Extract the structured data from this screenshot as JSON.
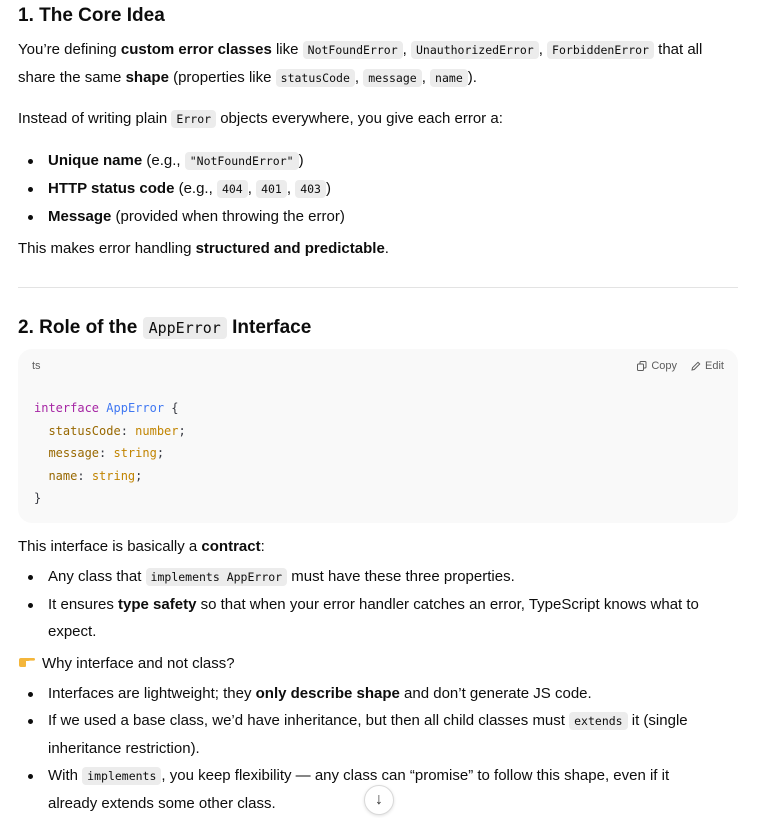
{
  "s1": {
    "title": "1. The Core Idea",
    "p1": [
      "You’re defining ",
      "custom error classes",
      " like ",
      "NotFoundError",
      ", ",
      "UnauthorizedError",
      ", ",
      "ForbiddenError",
      " that all share the same ",
      "shape",
      " (properties like ",
      "statusCode",
      ", ",
      "message",
      ", ",
      "name",
      ")."
    ],
    "p2": [
      "Instead of writing plain ",
      "Error",
      " objects everywhere, you give each error a:"
    ],
    "bullets": [
      [
        "Unique name",
        " (e.g., ",
        "\"NotFoundError\"",
        ")"
      ],
      [
        "HTTP status code",
        " (e.g., ",
        "404",
        ", ",
        "401",
        ", ",
        "403",
        ")"
      ],
      [
        "Message",
        " (provided when throwing the error)"
      ]
    ],
    "p3": [
      "This makes error handling ",
      "structured and predictable",
      "."
    ]
  },
  "s2": {
    "title_a": "2. Role of the ",
    "title_code": "AppError",
    "title_b": " Interface",
    "code": {
      "lang": "ts",
      "copy": "Copy",
      "edit": "Edit",
      "line1_kw": "interface",
      "line1_type": "AppError",
      "line1_brace": "{",
      "props": [
        {
          "name": "statusCode",
          "type": "number"
        },
        {
          "name": "message",
          "type": "string"
        },
        {
          "name": "name",
          "type": "string"
        }
      ],
      "close": "}"
    },
    "p1": [
      "This interface is basically a ",
      "contract",
      ":"
    ],
    "bullets": [
      [
        "Any class that ",
        "implements AppError",
        " must have these three properties."
      ],
      [
        "It ensures ",
        "type safety",
        " so that when your error handler catches an error, TypeScript knows what to expect."
      ]
    ],
    "why": "Why interface and not class?",
    "why_bullets": [
      [
        "Interfaces are lightweight; they ",
        "only describe shape",
        " and don’t generate JS code."
      ],
      [
        "If we used a base class, we’d have inheritance, but then all child classes must ",
        "extends",
        " it (single inheritance restriction)."
      ],
      [
        "With ",
        "implements",
        ", you keep flexibility — any class can “promise” to follow this shape, even if it already extends some other class."
      ]
    ]
  }
}
